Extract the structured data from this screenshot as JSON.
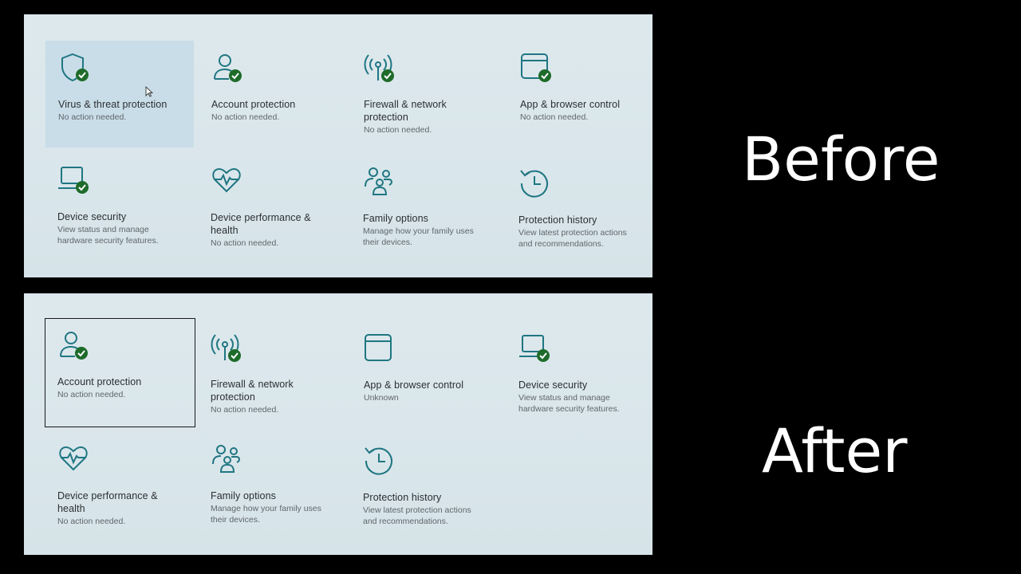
{
  "labels": {
    "before": "Before",
    "after": "After"
  },
  "colors": {
    "icon_stroke": "#1f7682",
    "check_fill": "#1e6b2a",
    "hover_tile": "#c9dde8"
  },
  "before": {
    "tiles": [
      {
        "icon": "shield-check-icon",
        "title": "Virus & threat protection",
        "sub": "No action needed."
      },
      {
        "icon": "person-check-icon",
        "title": "Account protection",
        "sub": "No action needed."
      },
      {
        "icon": "wifi-antenna-check-icon",
        "title": "Firewall & network protection",
        "sub": "No action needed."
      },
      {
        "icon": "app-window-check-icon",
        "title": "App & browser control",
        "sub": "No action needed."
      },
      {
        "icon": "laptop-check-icon",
        "title": "Device security",
        "sub": "View status and manage hardware security features."
      },
      {
        "icon": "heart-pulse-icon",
        "title": "Device performance & health",
        "sub": "No action needed."
      },
      {
        "icon": "family-icon",
        "title": "Family options",
        "sub": "Manage how your family uses their devices."
      },
      {
        "icon": "history-clock-icon",
        "title": "Protection history",
        "sub": "View latest protection actions and recommendations."
      }
    ]
  },
  "after": {
    "tiles": [
      {
        "icon": "person-check-icon",
        "title": "Account protection",
        "sub": "No action needed."
      },
      {
        "icon": "wifi-antenna-check-icon",
        "title": "Firewall & network protection",
        "sub": "No action needed."
      },
      {
        "icon": "app-window-icon",
        "title": "App & browser control",
        "sub": "Unknown"
      },
      {
        "icon": "laptop-check-icon",
        "title": "Device security",
        "sub": "View status and manage hardware security features."
      },
      {
        "icon": "heart-pulse-icon",
        "title": "Device performance & health",
        "sub": "No action needed."
      },
      {
        "icon": "family-icon",
        "title": "Family options",
        "sub": "Manage how your family uses their devices."
      },
      {
        "icon": "history-clock-icon",
        "title": "Protection history",
        "sub": "View latest protection actions and recommendations."
      }
    ]
  }
}
